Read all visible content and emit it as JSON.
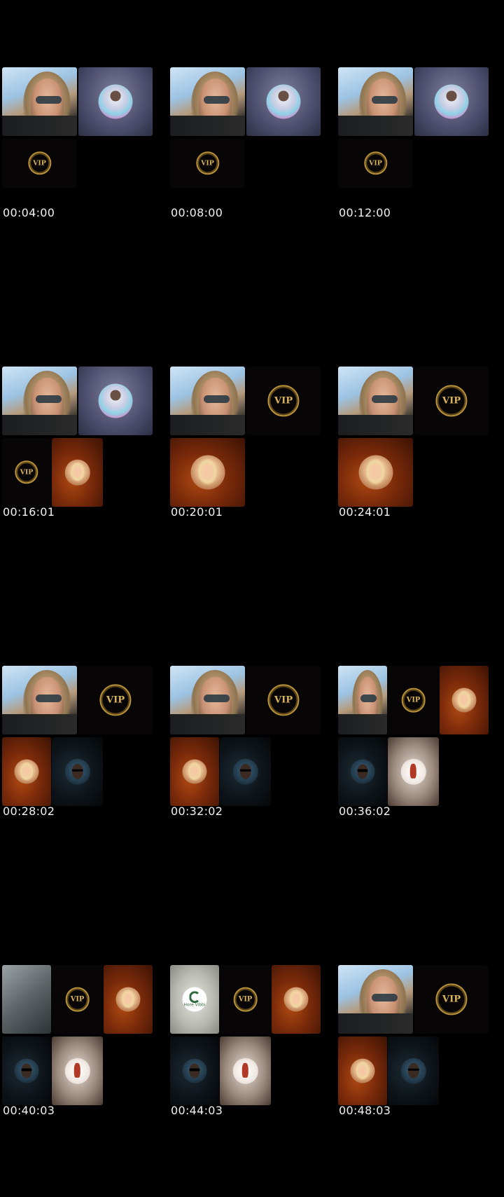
{
  "timestamps": [
    "00:04:00",
    "00:08:00",
    "00:12:00",
    "00:16:01",
    "00:20:01",
    "00:24:01",
    "00:28:02",
    "00:32:02",
    "00:36:02",
    "00:40:03",
    "00:44:03",
    "00:48:03"
  ],
  "emblem_text": "VIP",
  "logo_caption": "Hore Vibbi",
  "cells": [
    {
      "tiles": [
        {
          "kind": "cam",
          "name": "camera-tile"
        },
        {
          "kind": "blur",
          "avatar": "man",
          "name": "participant-tile"
        },
        {
          "kind": "vip",
          "name": "vip-emblem-tile"
        }
      ]
    },
    {
      "tiles": [
        {
          "kind": "cam",
          "name": "camera-tile"
        },
        {
          "kind": "blur",
          "avatar": "man",
          "name": "participant-tile"
        },
        {
          "kind": "vip",
          "name": "vip-emblem-tile"
        }
      ]
    },
    {
      "tiles": [
        {
          "kind": "cam",
          "name": "camera-tile"
        },
        {
          "kind": "blur",
          "avatar": "man",
          "name": "participant-tile"
        },
        {
          "kind": "vip",
          "name": "vip-emblem-tile"
        }
      ]
    },
    {
      "tiles": [
        {
          "kind": "cam",
          "name": "camera-tile"
        },
        {
          "kind": "blur",
          "avatar": "man",
          "name": "participant-tile"
        },
        {
          "kind": "vip",
          "name": "vip-emblem-tile"
        },
        {
          "kind": "orange",
          "avatar": "blonde",
          "name": "participant-tile"
        }
      ]
    },
    {
      "tiles": [
        {
          "kind": "cam",
          "name": "camera-tile"
        },
        {
          "kind": "vip",
          "name": "vip-emblem-tile"
        },
        {
          "kind": "orange",
          "avatar": "blonde",
          "name": "participant-tile"
        }
      ]
    },
    {
      "tiles": [
        {
          "kind": "cam",
          "name": "camera-tile"
        },
        {
          "kind": "vip",
          "name": "vip-emblem-tile"
        },
        {
          "kind": "orange",
          "avatar": "blonde",
          "name": "participant-tile"
        }
      ]
    },
    {
      "tiles": [
        {
          "kind": "cam",
          "name": "camera-tile"
        },
        {
          "kind": "vip",
          "name": "vip-emblem-tile"
        },
        {
          "kind": "orange",
          "avatar": "blonde",
          "name": "participant-tile"
        },
        {
          "kind": "dark",
          "avatar": "sun",
          "name": "participant-tile"
        }
      ]
    },
    {
      "tiles": [
        {
          "kind": "cam",
          "name": "camera-tile"
        },
        {
          "kind": "vip",
          "name": "vip-emblem-tile"
        },
        {
          "kind": "orange",
          "avatar": "blonde",
          "name": "participant-tile"
        },
        {
          "kind": "dark",
          "avatar": "sun",
          "name": "participant-tile"
        }
      ]
    },
    {
      "tiles": [
        {
          "kind": "cam",
          "name": "camera-tile"
        },
        {
          "kind": "vip",
          "name": "vip-emblem-tile"
        },
        {
          "kind": "orange",
          "avatar": "blonde",
          "name": "participant-tile"
        },
        {
          "kind": "dark",
          "avatar": "sun",
          "name": "participant-tile"
        },
        {
          "kind": "beige",
          "avatar": "red",
          "name": "participant-tile"
        }
      ]
    },
    {
      "tiles": [
        {
          "kind": "grey",
          "name": "camera-tile"
        },
        {
          "kind": "vip",
          "name": "vip-emblem-tile"
        },
        {
          "kind": "orange",
          "avatar": "blonde",
          "name": "participant-tile"
        },
        {
          "kind": "dark",
          "avatar": "sun",
          "name": "participant-tile"
        },
        {
          "kind": "beige",
          "avatar": "red",
          "name": "participant-tile"
        }
      ]
    },
    {
      "tiles": [
        {
          "kind": "lgrey",
          "avatar": "logo",
          "name": "participant-tile"
        },
        {
          "kind": "vip",
          "name": "vip-emblem-tile"
        },
        {
          "kind": "orange",
          "avatar": "blonde",
          "name": "participant-tile"
        },
        {
          "kind": "dark",
          "avatar": "sun",
          "name": "participant-tile"
        },
        {
          "kind": "beige",
          "avatar": "red",
          "name": "participant-tile"
        }
      ]
    },
    {
      "tiles": [
        {
          "kind": "cam",
          "name": "camera-tile"
        },
        {
          "kind": "vip",
          "name": "vip-emblem-tile"
        },
        {
          "kind": "orange",
          "avatar": "blonde",
          "name": "participant-tile"
        },
        {
          "kind": "dark",
          "avatar": "sun",
          "name": "participant-tile"
        }
      ]
    }
  ]
}
